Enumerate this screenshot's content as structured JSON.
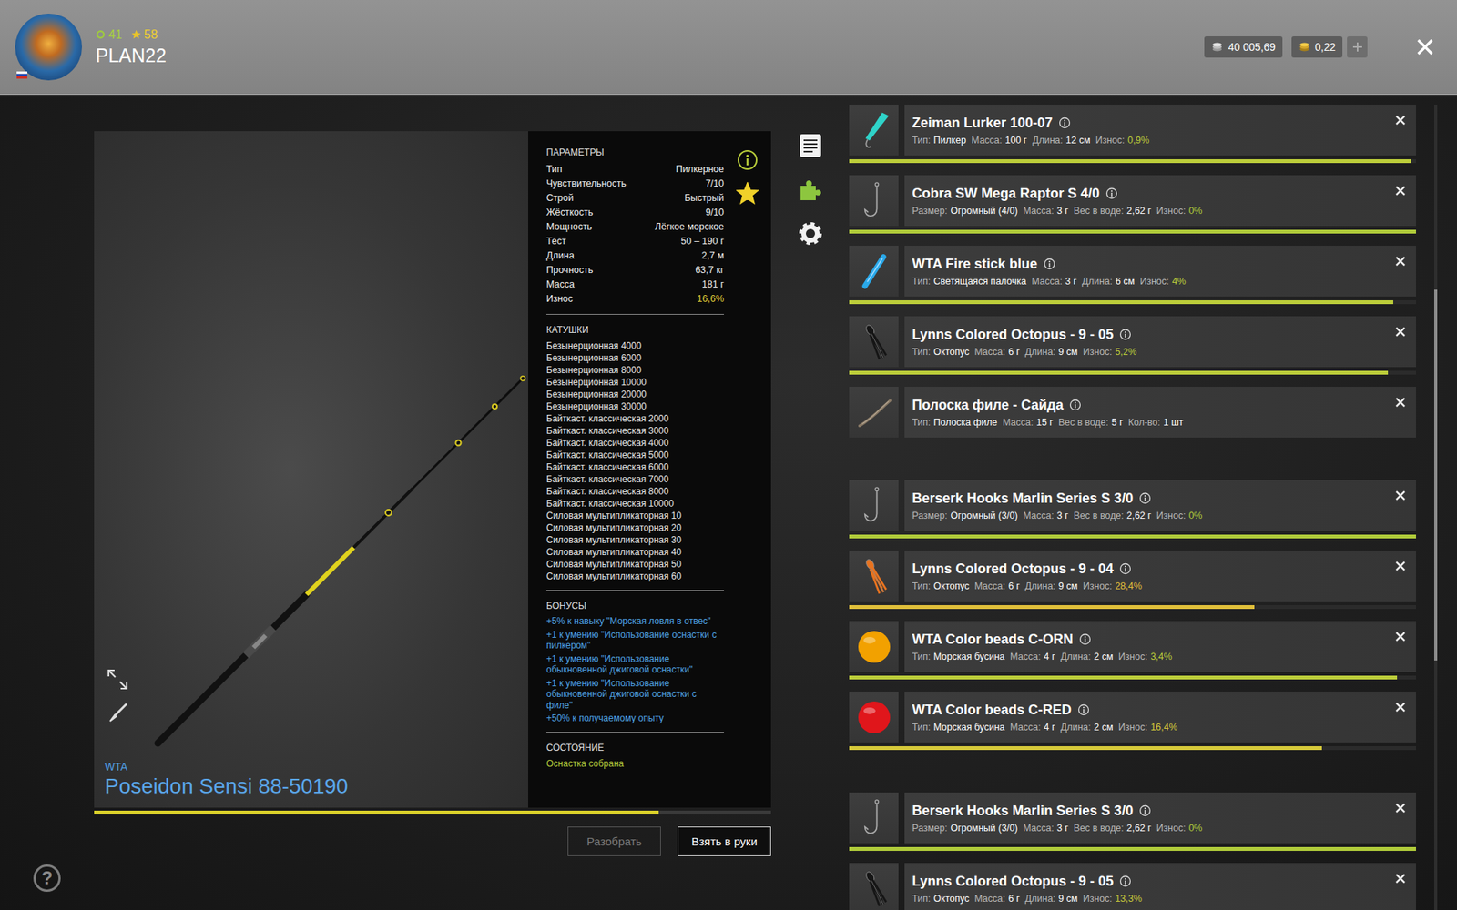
{
  "header": {
    "level": "41",
    "rank": "58",
    "username": "PLAN22",
    "silver": "40 005,69",
    "gold": "0,22"
  },
  "rod": {
    "brand": "WTA",
    "name": "Poseidon Sensi 88-50190",
    "level": 0.834,
    "favorite": true,
    "wear_color": "#e3d43a",
    "params_title": "ПАРАМЕТРЫ",
    "params": [
      {
        "label": "Тип",
        "value": "Пилкерное",
        "accent": false
      },
      {
        "label": "Чувствительность",
        "value": "7/10",
        "accent": false
      },
      {
        "label": "Строй",
        "value": "Быстрый",
        "accent": false
      },
      {
        "label": "Жёсткость",
        "value": "9/10",
        "accent": false
      },
      {
        "label": "Мощность",
        "value": "Лёгкое морское",
        "accent": false
      },
      {
        "label": "Тест",
        "value": "50 – 190 г",
        "accent": false
      },
      {
        "label": "Длина",
        "value": "2,7 м",
        "accent": false
      },
      {
        "label": "Прочность",
        "value": "63,7 кг",
        "accent": false
      },
      {
        "label": "Масса",
        "value": "181 г",
        "accent": false
      },
      {
        "label": "Износ",
        "value": "16,6%",
        "accent": true
      }
    ],
    "reels_title": "КАТУШКИ",
    "reels": [
      "Безынерционная 4000",
      "Безынерционная 6000",
      "Безынерционная 8000",
      "Безынерционная 10000",
      "Безынерционная 20000",
      "Безынерционная 30000",
      "Байткаст. классическая 2000",
      "Байткаст. классическая 3000",
      "Байткаст. классическая 4000",
      "Байткаст. классическая 5000",
      "Байткаст. классическая 6000",
      "Байткаст. классическая 7000",
      "Байткаст. классическая 8000",
      "Байткаст. классическая 10000",
      "Силовая мультипликаторная 10",
      "Силовая мультипликаторная 20",
      "Силовая мультипликаторная 30",
      "Силовая мультипликаторная 40",
      "Силовая мультипликаторная 50",
      "Силовая мультипликаторная 60"
    ],
    "bonuses_title": "БОНУСЫ",
    "bonuses": [
      "+5% к навыку \"Морская ловля в отвес\"",
      "+1 к умению \"Использование оснастки с пилкером\"",
      "+1 к умению \"Использование обыкновенной джиговой оснастки\"",
      "+1 к умению \"Использование обыкновенной джиговой оснастки с филе\"",
      "+50% к получаемому опыту"
    ],
    "state_title": "СОСТОЯНИЕ",
    "state": "Оснастка собрана"
  },
  "buttons": [
    {
      "label": "Разобрать",
      "disabled": true
    },
    {
      "label": "Взять в руки",
      "disabled": false
    }
  ],
  "tackle_groups": [
    {
      "items": [
        {
          "name": "Zeiman Lurker 100-07",
          "kind": "jig",
          "icon_color": "#2fd3c9",
          "color": "#bccd3a",
          "level": 0.99,
          "fields": [
            {
              "label": "Тип:",
              "value": "Пилкер",
              "accent": false
            },
            {
              "label": "Масса:",
              "value": "100 г",
              "accent": false
            },
            {
              "label": "Длина:",
              "value": "12 см",
              "accent": false
            },
            {
              "label": "Износ:",
              "value": "0,9%",
              "accent": true
            }
          ]
        },
        {
          "name": "Cobra SW Mega Raptor S 4/0",
          "kind": "hook",
          "icon_color": "#a9a9a9",
          "color": "#b0cb3a",
          "level": 1,
          "fields": [
            {
              "label": "Размер:",
              "value": "Огромный (4/0)",
              "accent": false
            },
            {
              "label": "Масса:",
              "value": "3 г",
              "accent": false
            },
            {
              "label": "Вес в воде:",
              "value": "2,62 г",
              "accent": false
            },
            {
              "label": "Износ:",
              "value": "0%",
              "accent": true
            }
          ]
        },
        {
          "name": "WTA Fire stick blue",
          "kind": "glowstick",
          "icon_color": "#2aa9ea",
          "color": "#bccd3a",
          "level": 0.96,
          "fields": [
            {
              "label": "Тип:",
              "value": "Светящаяся палочка",
              "accent": false
            },
            {
              "label": "Масса:",
              "value": "3 г",
              "accent": false
            },
            {
              "label": "Длина:",
              "value": "6 см",
              "accent": false
            },
            {
              "label": "Износ:",
              "value": "4%",
              "accent": true
            }
          ]
        },
        {
          "name": "Lynns Colored Octopus - 9 - 05",
          "kind": "octopus",
          "icon_color": "#151515",
          "color": "#bccd3a",
          "level": 0.95,
          "fields": [
            {
              "label": "Тип:",
              "value": "Октопус",
              "accent": false
            },
            {
              "label": "Масса:",
              "value": "6 г",
              "accent": false
            },
            {
              "label": "Длина:",
              "value": "9 см",
              "accent": false
            },
            {
              "label": "Износ:",
              "value": "5,2%",
              "accent": true
            }
          ]
        },
        {
          "name": "Полоска филе - Сайда",
          "kind": "fillet",
          "icon_color": "#8a7a66",
          "fields": [
            {
              "label": "Тип:",
              "value": "Полоска филе",
              "accent": false
            },
            {
              "label": "Масса:",
              "value": "15 г",
              "accent": false
            },
            {
              "label": "Вес в воде:",
              "value": "5 г",
              "accent": false
            },
            {
              "label": "Кол-во:",
              "value": "1 шт",
              "accent": false
            }
          ]
        }
      ]
    },
    {
      "items": [
        {
          "name": "Berserk Hooks Marlin Series S 3/0",
          "kind": "hook",
          "icon_color": "#a9a9a9",
          "color": "#b0cb3a",
          "level": 1,
          "fields": [
            {
              "label": "Размер:",
              "value": "Огромный (3/0)",
              "accent": false
            },
            {
              "label": "Масса:",
              "value": "3 г",
              "accent": false
            },
            {
              "label": "Вес в воде:",
              "value": "2,62 г",
              "accent": false
            },
            {
              "label": "Износ:",
              "value": "0%",
              "accent": true
            }
          ]
        },
        {
          "name": "Lynns Colored Octopus - 9 - 04",
          "kind": "octopus",
          "icon_color": "#e8731f",
          "color": "#e0bf3a",
          "level": 0.715,
          "fields": [
            {
              "label": "Тип:",
              "value": "Октопус",
              "accent": false
            },
            {
              "label": "Масса:",
              "value": "6 г",
              "accent": false
            },
            {
              "label": "Длина:",
              "value": "9 см",
              "accent": false
            },
            {
              "label": "Износ:",
              "value": "28,4%",
              "accent": true
            }
          ]
        },
        {
          "name": "WTA Color beads C-ORN",
          "kind": "bead",
          "icon_color": "#f2a100",
          "color": "#bccd3a",
          "level": 0.966,
          "fields": [
            {
              "label": "Тип:",
              "value": "Морская бусина",
              "accent": false
            },
            {
              "label": "Масса:",
              "value": "4 г",
              "accent": false
            },
            {
              "label": "Длина:",
              "value": "2 см",
              "accent": false
            },
            {
              "label": "Износ:",
              "value": "3,4%",
              "accent": true
            }
          ]
        },
        {
          "name": "WTA Color beads C-RED",
          "kind": "bead",
          "icon_color": "#e0161b",
          "color": "#d6c93a",
          "level": 0.834,
          "fields": [
            {
              "label": "Тип:",
              "value": "Морская бусина",
              "accent": false
            },
            {
              "label": "Масса:",
              "value": "4 г",
              "accent": false
            },
            {
              "label": "Длина:",
              "value": "2 см",
              "accent": false
            },
            {
              "label": "Износ:",
              "value": "16,4%",
              "accent": true
            }
          ]
        }
      ]
    },
    {
      "items": [
        {
          "name": "Berserk Hooks Marlin Series S 3/0",
          "kind": "hook",
          "icon_color": "#a9a9a9",
          "color": "#b0cb3a",
          "level": 1,
          "fields": [
            {
              "label": "Размер:",
              "value": "Огромный (3/0)",
              "accent": false
            },
            {
              "label": "Масса:",
              "value": "3 г",
              "accent": false
            },
            {
              "label": "Вес в воде:",
              "value": "2,62 г",
              "accent": false
            },
            {
              "label": "Износ:",
              "value": "0%",
              "accent": true
            }
          ]
        },
        {
          "name": "Lynns Colored Octopus - 9 - 05",
          "kind": "octopus",
          "icon_color": "#151515",
          "color": "#c8cc3a",
          "fields": [
            {
              "label": "Тип:",
              "value": "Октопус",
              "accent": false
            },
            {
              "label": "Масса:",
              "value": "6 г",
              "accent": false
            },
            {
              "label": "Длина:",
              "value": "9 см",
              "accent": false
            },
            {
              "label": "Износ:",
              "value": "13,3%",
              "accent": true
            }
          ]
        }
      ]
    }
  ],
  "scrollbar": {
    "position": 0.23,
    "size": 0.46
  },
  "help": "?"
}
